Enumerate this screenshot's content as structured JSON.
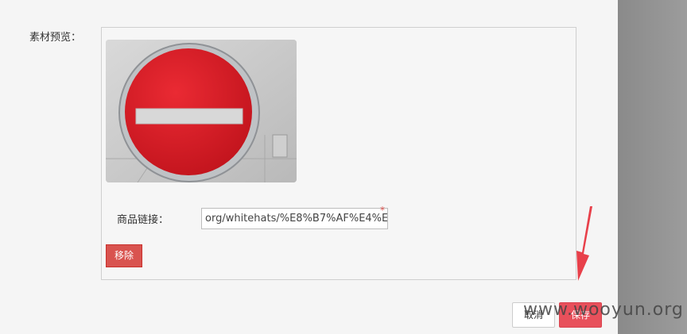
{
  "preview": {
    "label": "素材预览："
  },
  "image": {
    "icon": "no-entry-sign-icon",
    "sign_color": "#e0212b",
    "bar_color": "#d8d8d8"
  },
  "link": {
    "label": "商品链接：",
    "value": "org/whitehats/%E8%B7%AF%E4%E",
    "required_mark": "*"
  },
  "buttons": {
    "remove": "移除",
    "cancel": "取消",
    "confirm": "保存"
  },
  "watermark": {
    "text": "www.wooyun.org"
  },
  "colors": {
    "accent_red": "#d9534f",
    "confirm_red": "#e8505b",
    "arrow_red": "#e8404a"
  }
}
